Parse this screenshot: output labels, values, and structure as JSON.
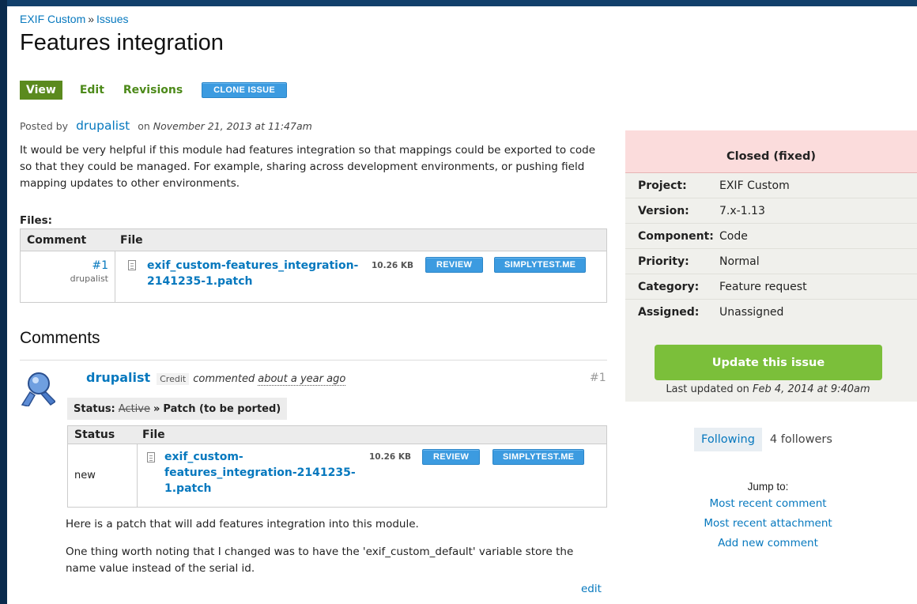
{
  "breadcrumb": {
    "project": "EXIF Custom",
    "separator": "»",
    "section": "Issues"
  },
  "page_title": "Features integration",
  "tabs": {
    "view": "View",
    "edit": "Edit",
    "revisions": "Revisions",
    "clone": "CLONE ISSUE"
  },
  "post": {
    "posted_by": "Posted by",
    "author": "drupalist",
    "on": "on",
    "date": "November 21, 2013 at 11:47am",
    "body": "It would be very helpful if this module had features integration so that mappings could be exported to code so that they could be managed. For example, sharing across development environments, or pushing field mapping updates to other environments."
  },
  "files": {
    "label": "Files:",
    "headers": {
      "comment": "Comment",
      "file": "File"
    },
    "row": {
      "comment_num": "#1",
      "comment_author": "drupalist",
      "file_line1": "exif_custom-features_integration-",
      "file_line2": "2141235-1.patch",
      "size": "10.26 KB",
      "review": "REVIEW",
      "simplytest": "SIMPLYTEST.ME"
    }
  },
  "comments": {
    "heading": "Comments",
    "item": {
      "author": "drupalist",
      "credit": "Credit",
      "verb": "commented",
      "time": "about a year ago",
      "number": "#1",
      "status_label": "Status:",
      "status_old": "Active",
      "status_arrow": "»",
      "status_new": "Patch (to be ported)",
      "table_headers": {
        "status": "Status",
        "file": "File"
      },
      "table_row": {
        "status": "new",
        "file_line1": "exif_custom-",
        "file_line2": "features_integration-2141235-",
        "file_line3": "1.patch",
        "size": "10.26 KB",
        "review": "REVIEW",
        "simplytest": "SIMPLYTEST.ME"
      },
      "body_p1": "Here is a patch that will add features integration into this module.",
      "body_p2": "One thing worth noting that I changed was to have the 'exif_custom_default' variable store the name value instead of the serial id.",
      "edit": "edit"
    }
  },
  "sidebar": {
    "status": "Closed (fixed)",
    "meta": [
      {
        "key": "Project:",
        "value": "EXIF Custom"
      },
      {
        "key": "Version:",
        "value": "7.x-1.13"
      },
      {
        "key": "Component:",
        "value": "Code"
      },
      {
        "key": "Priority:",
        "value": "Normal"
      },
      {
        "key": "Category:",
        "value": "Feature request"
      },
      {
        "key": "Assigned:",
        "value": "Unassigned"
      }
    ],
    "update_button": "Update this issue",
    "last_updated_prefix": "Last updated on",
    "last_updated_date": "Feb 4, 2014 at 9:40am",
    "following_button": "Following",
    "followers": "4 followers",
    "jump_label": "Jump to:",
    "jump_links": [
      "Most recent comment",
      "Most recent attachment",
      "Add new comment"
    ]
  },
  "colors": {
    "link": "#0678be",
    "tab_active": "#5b8a1e",
    "button_blue": "#3c9be0",
    "update_green": "#7bbf3a",
    "status_closed_bg": "#fbdcdc",
    "sidebar_bg": "#f0f0ec"
  },
  "icons": {
    "file": "document-icon",
    "avatar": "user-avatar-icon"
  }
}
